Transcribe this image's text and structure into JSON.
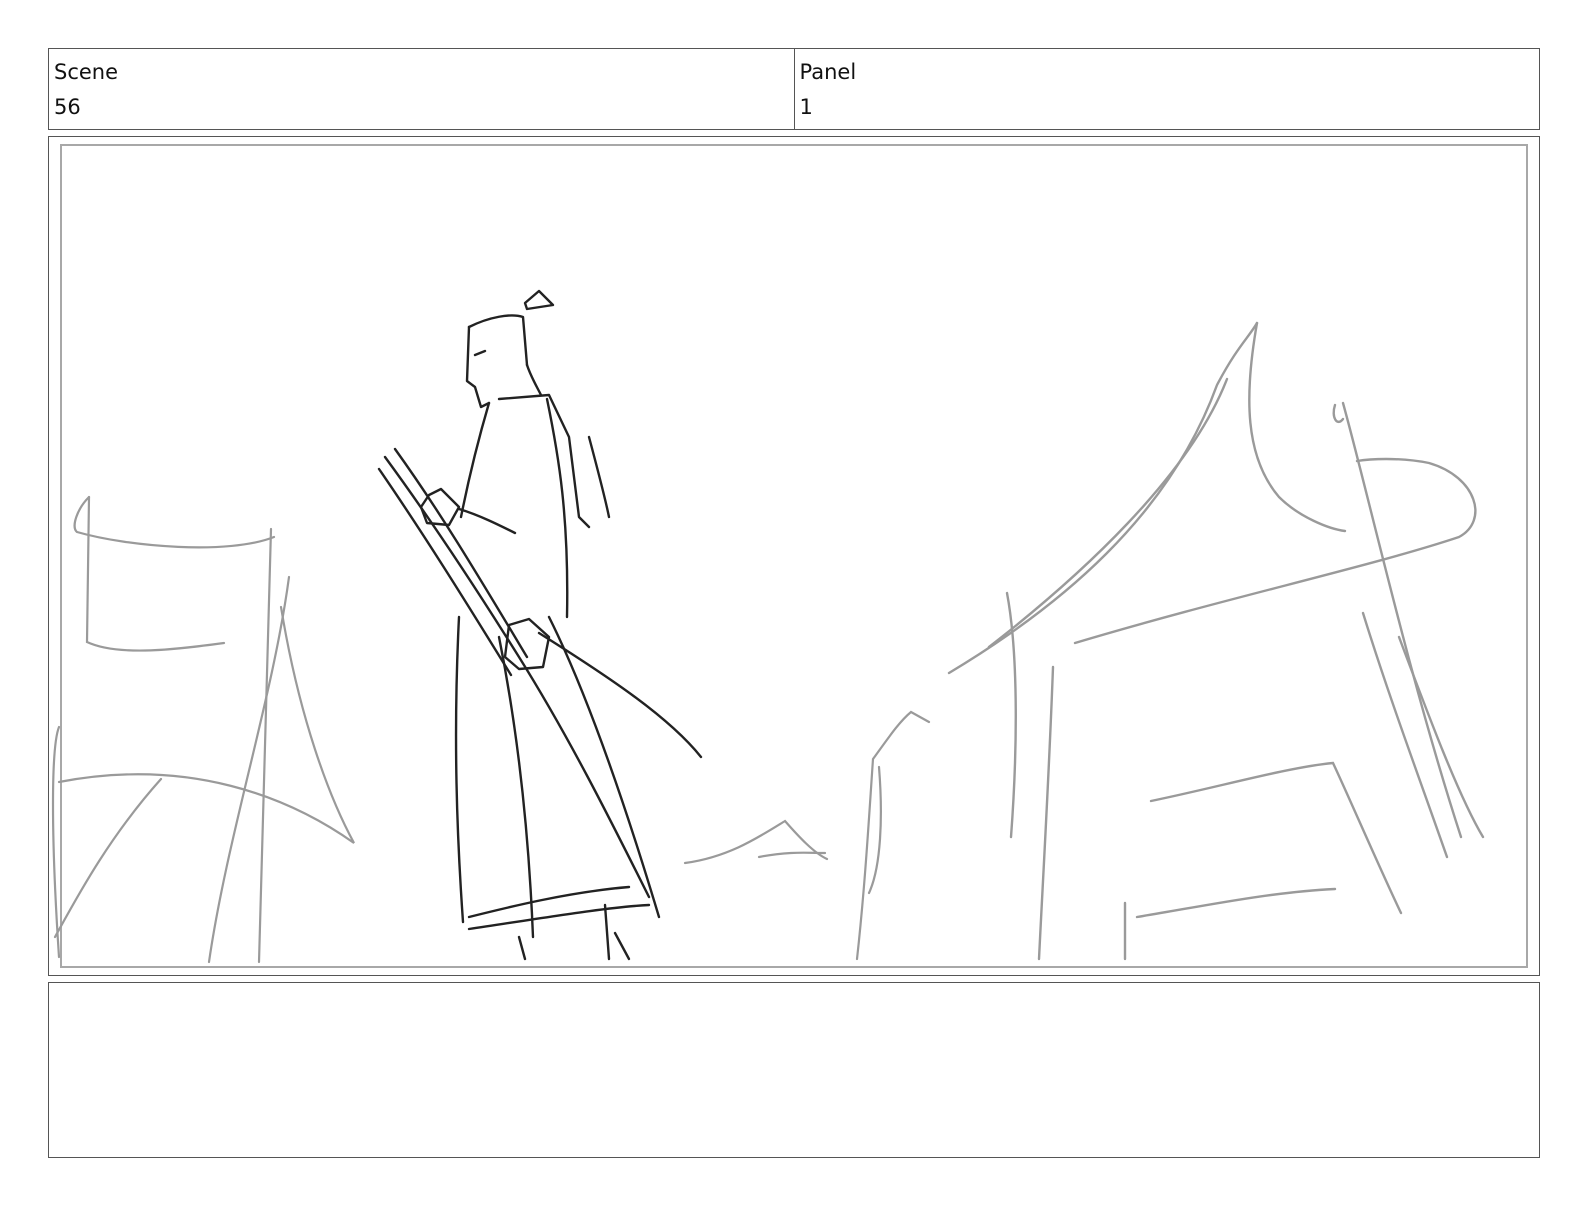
{
  "header": {
    "scene_label": "Scene",
    "scene_value": "56",
    "panel_label": "Panel",
    "panel_value": "1"
  },
  "panel": {
    "sketch_colors": {
      "foreground": "#222222",
      "background": "#9a9a9a"
    }
  },
  "notes": {
    "text": ""
  }
}
